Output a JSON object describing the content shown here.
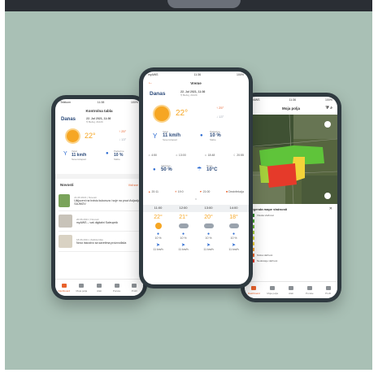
{
  "colors": {
    "accent": "#e8622c",
    "sun": "#f6a623",
    "field_green": "#5fc43a",
    "field_red": "#e53a2a",
    "field_yellow": "#f3d33a"
  },
  "phone_left": {
    "status_left": "Telekom",
    "status_time": "11:38",
    "status_right": "100%",
    "title": "Kontrolna tabla",
    "today_label": "Danas",
    "date_line": "22. Jul 2021, 11:36",
    "location": "Bečej, 21220",
    "temp": "22°",
    "temp_high": "25°",
    "temp_low": "13°",
    "wind_label": "Vetar",
    "wind_value": "11 km/h",
    "wind_sub": "Severozapad",
    "rain_label": "Padavine",
    "rain_value": "10 %",
    "rain_sub": "Slabe",
    "news_title": "Novosti",
    "news_more": "Vidi sve",
    "news": [
      {
        "date": "21.06.2021 | Novosti",
        "text": "Ukljuceni na trzistu kukuruza i soje na pruzi Avijacija SAJMOV"
      },
      {
        "date": "20.06.2021 | Novosti",
        "text": "myAWS – vaš digitalni Saleupnik"
      },
      {
        "date": "18.06.2021 | Zaštita bilja",
        "text": "Novo iskustvo sa savetima proizvođača"
      }
    ],
    "tabs": [
      "Dashboard",
      "Moja polja",
      "Alati",
      "Poruke",
      "Profil"
    ]
  },
  "phone_mid": {
    "status_left": "myAWS",
    "status_time": "11:36",
    "status_right": "100%",
    "title": "Vreme",
    "today_label": "Danas",
    "date_line": "22. Jul 2021, 11:36",
    "location": "Bečej, 21220",
    "temp": "22°",
    "temp_high": "25°",
    "temp_low": "13°",
    "wind_label": "Vetar",
    "wind_value": "11 km/h",
    "wind_sub": "Severozapad",
    "rain_label": "Padavine",
    "rain_value": "10 %",
    "rain_sub": "Slabe",
    "sun_times": [
      "4:50",
      "13:00",
      "18:48",
      "20:55"
    ],
    "humidity_label": "Vlažnost",
    "humidity_value": "50 %",
    "dew_label": "Rosa",
    "dew_value": "10°C",
    "spray_items": [
      "20:11",
      "19:0",
      "21:00",
      "Dezinfekcija"
    ],
    "hours": [
      "11:00",
      "12:00",
      "13:00",
      "14:00"
    ],
    "hour_temps": [
      "22°",
      "21°",
      "20°",
      "18°"
    ],
    "hour_rain": [
      "10 %",
      "10 %",
      "10 %",
      "10 %"
    ],
    "hour_wind": [
      "11 km/h",
      "11 km/h",
      "11 km/h",
      "11 km/h"
    ]
  },
  "phone_right": {
    "status_left": "myAWS",
    "status_time": "11:36",
    "status_right": "100%",
    "title": "Moja polja",
    "legend_title": "Legenda mape vlažnosti",
    "legend_items": [
      "Visoka vlažnost",
      "",
      "",
      "",
      "",
      "",
      "",
      "Niska vlažnost",
      "Nedostaje vlažnost"
    ],
    "legend_colors": [
      "#2f8a2a",
      "#4aa831",
      "#73c13a",
      "#a5d13c",
      "#d7dd3d",
      "#f3d33a",
      "#f3a53a",
      "#ee6b2f",
      "#e53a2a"
    ],
    "tabs": [
      "Dashboard",
      "Moja polja",
      "Alati",
      "Poruke",
      "Profil"
    ]
  }
}
